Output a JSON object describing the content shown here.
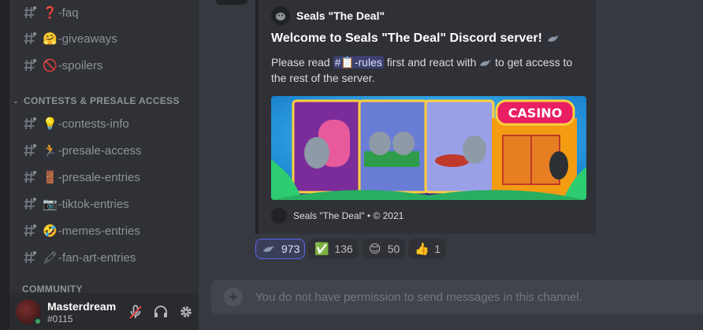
{
  "sidebar": {
    "channels_top": [
      {
        "emoji": "❓",
        "name": "-faq"
      },
      {
        "emoji": "🤗",
        "name": "-giveaways"
      },
      {
        "emoji": "🚫",
        "name": "-spoilers"
      }
    ],
    "category": "CONTESTS & PRESALE ACCESS",
    "channels": [
      {
        "emoji": "💡",
        "name": "-contests-info"
      },
      {
        "emoji": "🏃",
        "name": "-presale-access"
      },
      {
        "emoji": "🚪",
        "name": "-presale-entries"
      },
      {
        "emoji": "📷",
        "name": "-tiktok-entries"
      },
      {
        "emoji": "🤣",
        "name": "-memes-entries"
      },
      {
        "emoji": "🖍",
        "name": "-fan-art-entries"
      }
    ],
    "category_community": "COMMUNITY"
  },
  "user": {
    "name": "Masterdream",
    "tag": "#0115"
  },
  "embed": {
    "author": "Seals \"The Deal\"",
    "title": "Welcome to Seals \"The Deal\" Discord server!",
    "desc_prefix": "Please read ",
    "mention_hash": "#",
    "mention_emoji": "📋",
    "mention_name": "-rules",
    "desc_middle": " first and react with ",
    "desc_suffix": " to get access to the rest of the server.",
    "image_sign": "CASINO",
    "footer": "Seals \"The Deal\" • © 2021"
  },
  "reactions": [
    {
      "emoji": "seal",
      "count": "973",
      "active": true
    },
    {
      "emoji": "✅",
      "count": "136",
      "active": false
    },
    {
      "emoji": "😊",
      "count": "50",
      "active": false
    },
    {
      "emoji": "👍",
      "count": "1",
      "active": false
    }
  ],
  "composer": {
    "placeholder": "You do not have permission to send messages in this channel."
  },
  "colors": {
    "accent": "#5865f2",
    "online": "#3ba55d",
    "sidebar_bg": "#2f3136",
    "main_bg": "#36393f"
  }
}
